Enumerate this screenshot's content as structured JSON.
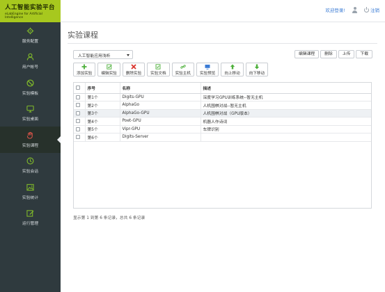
{
  "brand": {
    "title": "人工智能实验平台",
    "subtitle": "eLabEngine for Artificial Intelligence"
  },
  "topbar": {
    "welcome": "欢迎登录!",
    "logout": "注销"
  },
  "sidebar": {
    "items": [
      {
        "label": "服务配置",
        "icon": "gear-icon"
      },
      {
        "label": "用户帐号",
        "icon": "user-icon"
      },
      {
        "label": "实验模板",
        "icon": "ban-icon"
      },
      {
        "label": "实验桌面",
        "icon": "monitor-icon"
      },
      {
        "label": "实验课程",
        "icon": "hand-icon"
      },
      {
        "label": "实验会话",
        "icon": "clock-icon"
      },
      {
        "label": "实验统计",
        "icon": "image-icon"
      },
      {
        "label": "运行管理",
        "icon": "edit-icon"
      }
    ]
  },
  "page": {
    "title": "实验课程"
  },
  "course_select": {
    "value": "人工智能应用浅析"
  },
  "right_buttons": {
    "edit_course": "编辑课程",
    "delete": "删除",
    "upload": "上传",
    "download": "下载"
  },
  "toolbar": {
    "add": "添加实验",
    "edit": "编辑实验",
    "delete": "删除实验",
    "doc": "实验文档",
    "host": "实验主机",
    "preview": "实验预览",
    "move_up": "向上移动",
    "move_down": "向下移动"
  },
  "table": {
    "headers": {
      "index": "序号",
      "name": "名称",
      "desc": "描述"
    },
    "rows": [
      {
        "index": "第1个",
        "name": "Digits-GPU",
        "desc": "深度学习GPU训练系统--暂无主机"
      },
      {
        "index": "第2个",
        "name": "AlphaGo",
        "desc": "人机围棋对战--暂无主机"
      },
      {
        "index": "第3个",
        "name": "AlphaGo-GPU",
        "desc": "人机围棋对战（GPU版本）"
      },
      {
        "index": "第4个",
        "name": "Poet-GPU",
        "desc": "机器人作诗词"
      },
      {
        "index": "第5个",
        "name": "Vipr-GPU",
        "desc": "车牌识别"
      },
      {
        "index": "第6个",
        "name": "Digits-Server",
        "desc": ""
      }
    ]
  },
  "pager": {
    "text": "显示第 1 到第 6 条记录，总共 6 条记录"
  },
  "colors": {
    "brand": "#a7c81e",
    "sidebar": "#2f3a3e",
    "icon_green": "#7fb82a",
    "link": "#3a7bd5"
  }
}
